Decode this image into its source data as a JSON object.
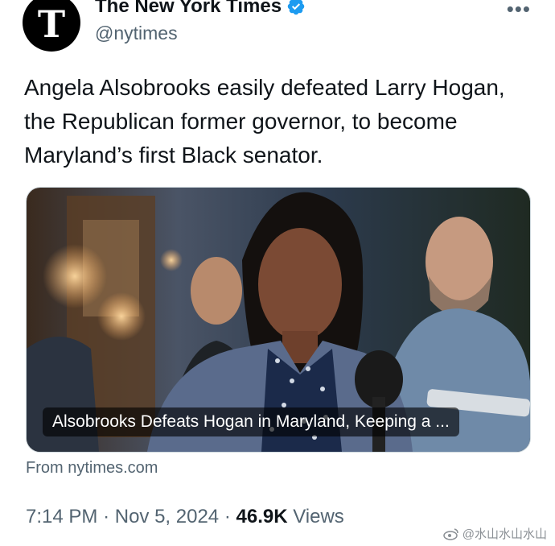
{
  "account": {
    "avatar_glyph": "T",
    "name": "The New York Times",
    "handle": "@nytimes",
    "verified": true,
    "verified_color": "#1d9bf0"
  },
  "more_icon": "more-icon",
  "more_glyph": "•••",
  "tweet": {
    "text": "Angela Alsobrooks easily defeated Larry Hogan, the Republican former governor, to become Maryland’s first Black senator."
  },
  "card": {
    "title": "Alsobrooks Defeats Hogan in Maryland, Keeping a ...",
    "source": "From nytimes.com"
  },
  "meta": {
    "time": "7:14 PM",
    "separator": "·",
    "date": "Nov 5, 2024",
    "views_count": "46.9K",
    "views_label": "Views"
  },
  "watermark": {
    "text": "@水山水山水山"
  }
}
